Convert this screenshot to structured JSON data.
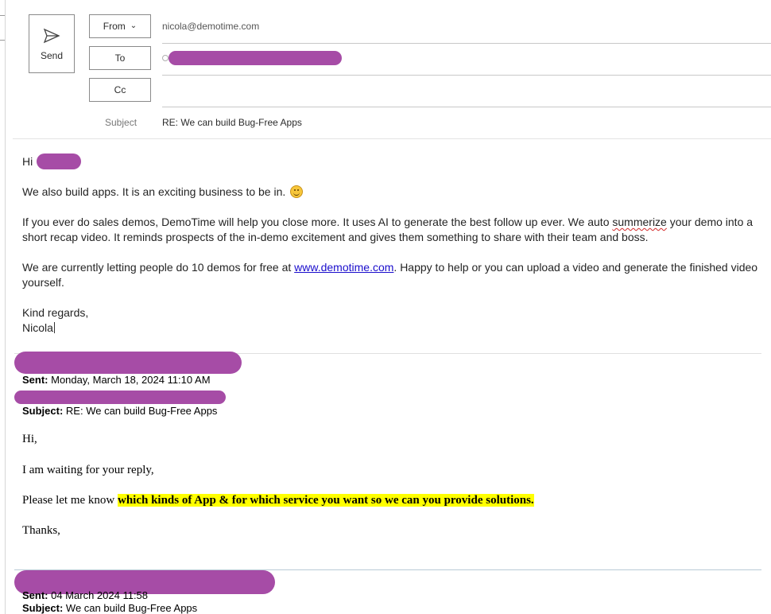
{
  "compose": {
    "send_label": "Send",
    "from_label": "From",
    "to_label": "To",
    "cc_label": "Cc",
    "from_value": "nicola@demotime.com",
    "subject_label": "Subject",
    "subject_value": "RE: We can build Bug-Free Apps"
  },
  "message": {
    "greeting": "Hi ",
    "p1": "We also build apps. It is an exciting business to be in.",
    "p2_a": "If you ever do sales demos, DemoTime will help you close more. It uses AI to generate the best follow up ever.  We auto ",
    "p2_misspelled": "summerize",
    "p2_b": " your demo into a short recap video. It reminds prospects of the in-demo excitement and gives them something to share with their team and boss.",
    "p3_a": "We are currently letting people do 10 demos for free at ",
    "p3_link": "www.demotime.com",
    "p3_b": ". Happy to help or you can upload a video and generate the finished video yourself.",
    "closing": "Kind regards,",
    "signature": "Nicola"
  },
  "quoted1": {
    "sent_label": "Sent:",
    "sent_value": " Monday, March 18, 2024 11:10 AM",
    "subject_label": "Subject:",
    "subject_value": " RE: We can build Bug-Free Apps",
    "hi": "Hi,",
    "waiting": "I am waiting for your reply,",
    "ask_a": "Please let me know ",
    "ask_highlight": "which kinds of App & for which service you want so we can you provide solutions.",
    "thanks": "Thanks,"
  },
  "quoted2": {
    "sent_label": "Sent:",
    "sent_value": " 04 March 2024 11:58",
    "subject_label": "Subject:",
    "subject_value": " We can build Bug-Free Apps"
  },
  "colors": {
    "redaction": "#a64ca6",
    "highlight": "#ffff00",
    "link": "#1a0dcc"
  }
}
